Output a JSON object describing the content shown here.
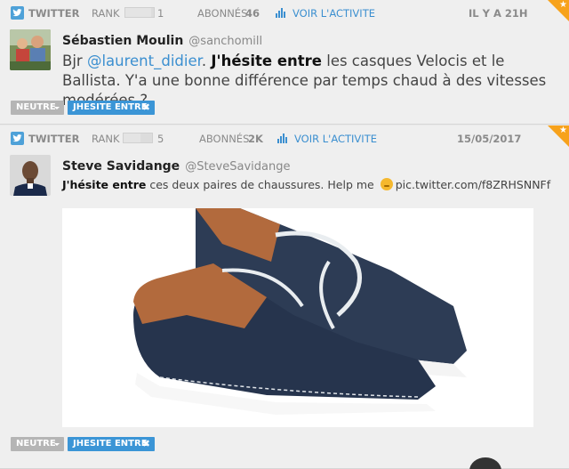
{
  "posts": [
    {
      "network": "TWITTER",
      "rank_label": "RANK",
      "rank_value": "1",
      "abonnes_label": "ABONNÉS",
      "abonnes_value": "46",
      "activity_link": "VOIR L'ACTIVITE",
      "date": "IL Y A 21H",
      "author": "Sébastien Moulin",
      "handle": "@sanchomill",
      "text": {
        "pre": "Bjr ",
        "mention": "@laurent_didier",
        "mid": ". ",
        "keyword": "J'hésite entre",
        "post": " les casques Velocis et le Ballista. Y'a une bonne différence par temps chaud à des vitesses modérées ?"
      },
      "tags": {
        "sentiment": "NEUTRE",
        "category": "JHESITE ENTRE"
      },
      "rank_level": 0.9
    },
    {
      "network": "TWITTER",
      "rank_label": "RANK",
      "rank_value": "5",
      "abonnes_label": "ABONNÉS",
      "abonnes_value": "2K",
      "activity_link": "VOIR L'ACTIVITE",
      "date": "15/05/2017",
      "author": "Steve Savidange",
      "handle": "@SteveSavidange",
      "text": {
        "keyword": "J'hésite entre",
        "post": " ces deux paires de chaussures. Help me ",
        "link": "pic.twitter.com/f8ZRHSNNFf"
      },
      "tags": {
        "sentiment": "NEUTRE",
        "category": "JHESITE ENTRE"
      },
      "rank_level": 0.6
    }
  ],
  "icons": {
    "network": "twitter-bird-icon",
    "activity": "bar-chart-icon",
    "corner": "star-icon",
    "dropdown": "caret-down-icon",
    "remove": "close-icon",
    "emoji": "thinking-face-icon"
  },
  "colors": {
    "twitter_blue": "#4ea1d8",
    "link_blue": "#3b8fd0",
    "tag_blue": "#3b95d6",
    "tag_grey": "#b5b5b5",
    "corner_orange": "#f7a21b"
  }
}
